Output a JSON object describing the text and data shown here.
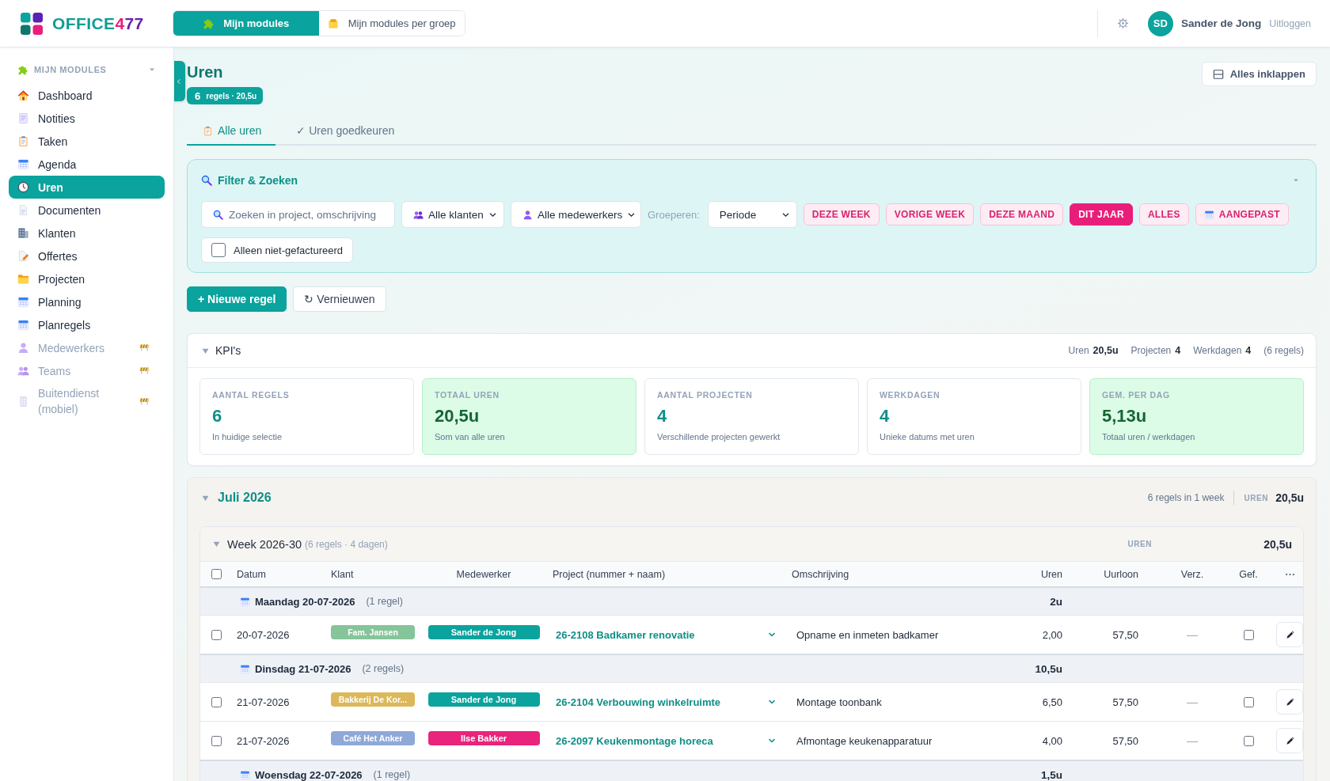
{
  "header": {
    "logo": {
      "word": "OFFICE",
      "number": "477"
    },
    "module_tabs": [
      {
        "label": "Mijn modules",
        "selected": true
      },
      {
        "label": "Mijn modules per groep",
        "selected": false
      }
    ],
    "user": {
      "initials": "SD",
      "name": "Sander de Jong"
    },
    "logout": "Uitloggen"
  },
  "sidebar": {
    "title": "MIJN MODULES",
    "items": [
      {
        "label": "Dashboard",
        "selected": false,
        "disabled": false
      },
      {
        "label": "Notities",
        "selected": false,
        "disabled": false
      },
      {
        "label": "Taken",
        "selected": false,
        "disabled": false
      },
      {
        "label": "Agenda",
        "selected": false,
        "disabled": false
      },
      {
        "label": "Uren",
        "selected": true,
        "disabled": false
      },
      {
        "label": "Documenten",
        "selected": false,
        "disabled": false
      },
      {
        "label": "Klanten",
        "selected": false,
        "disabled": false
      },
      {
        "label": "Offertes",
        "selected": false,
        "disabled": false
      },
      {
        "label": "Projecten",
        "selected": false,
        "disabled": false
      },
      {
        "label": "Planning",
        "selected": false,
        "disabled": false
      },
      {
        "label": "Planregels",
        "selected": false,
        "disabled": false
      },
      {
        "label": "Medewerkers",
        "selected": false,
        "disabled": true
      },
      {
        "label": "Teams",
        "selected": false,
        "disabled": true
      },
      {
        "label": "Buitendienst (mobiel)",
        "selected": false,
        "disabled": true
      }
    ]
  },
  "page": {
    "title": "Uren",
    "badge": {
      "count": "6",
      "label": "regels · 20,5u"
    },
    "collapse_all": "Alles inklappen",
    "tabs": [
      {
        "label": "Alle uren",
        "selected": true
      },
      {
        "label": "✓ Uren goedkeuren",
        "selected": false
      }
    ]
  },
  "filter": {
    "title": "Filter & Zoeken",
    "search": {
      "placeholder": "Zoeken in project, omschrijving"
    },
    "client_select": "Alle klanten",
    "employee_select": "Alle medewerkers",
    "group_label": "Groeperen:",
    "group_select": "Periode",
    "periods": [
      {
        "label": "DEZE WEEK",
        "selected": false
      },
      {
        "label": "VORIGE WEEK",
        "selected": false
      },
      {
        "label": "DEZE MAAND",
        "selected": false
      },
      {
        "label": "DIT JAAR",
        "selected": true
      },
      {
        "label": "ALLES",
        "selected": false
      },
      {
        "label": "AANGEPAST",
        "selected": false
      }
    ],
    "only_unbilled": {
      "label": "Alleen niet-gefactureerd",
      "checked": false
    }
  },
  "actions": [
    {
      "label": "+ Nieuwe regel",
      "kind": "primary"
    },
    {
      "label": "↻ Vernieuwen",
      "kind": "secondary"
    }
  ],
  "kpis": {
    "title": "KPI's",
    "expanded": true,
    "summary": [
      {
        "label": "Uren",
        "value": "20,5u"
      },
      {
        "label": "Projecten",
        "value": "4"
      },
      {
        "label": "Werkdagen",
        "value": "4"
      }
    ],
    "summary_note": "(6 regels)",
    "cards": [
      {
        "label": "AANTAL REGELS",
        "value": "6",
        "description": "In huidige selectie",
        "highlight": false
      },
      {
        "label": "TOTAAL UREN",
        "value": "20,5u",
        "description": "Som van alle uren",
        "highlight": true
      },
      {
        "label": "AANTAL PROJECTEN",
        "value": "4",
        "description": "Verschillende projecten gewerkt",
        "highlight": false
      },
      {
        "label": "WERKDAGEN",
        "value": "4",
        "description": "Unieke datums met uren",
        "highlight": false
      },
      {
        "label": "GEM. PER DAG",
        "value": "5,13u",
        "description": "Totaal uren / werkdagen",
        "highlight": true
      }
    ]
  },
  "month": {
    "title": "Juli 2026",
    "expanded": true,
    "summary": "6 regels in 1 week",
    "total_label": "UREN",
    "total": "20,5u",
    "week": {
      "title": "Week 2026-30",
      "note": "(6 regels · 4 dagen)",
      "expanded": true,
      "total_label": "UREN",
      "total": "20,5u",
      "table": {
        "all_selected": false,
        "columns": [
          "Datum",
          "Klant",
          "Medewerker",
          "Project (nummer + naam)",
          "Omschrijving",
          "Uren",
          "Uurloon",
          "Verz.",
          "Gef.",
          "⋯"
        ],
        "days": [
          {
            "title": "Maandag 20-07-2026",
            "count": "(1 regel)",
            "total": "2u",
            "rows": [
              {
                "selected": false,
                "date": "20-07-2026",
                "client": {
                  "name": "Fam. Jansen",
                  "color": "#86c49a"
                },
                "employee": {
                  "name": "Sander de Jong",
                  "color": "#0aa39d"
                },
                "project": "26-2108 Badkamer renovatie",
                "description": "Opname en inmeten badkamer",
                "hours": "2,00",
                "rate": "57,50",
                "sent": "—",
                "billed": false
              }
            ]
          },
          {
            "title": "Dinsdag 21-07-2026",
            "count": "(2 regels)",
            "total": "10,5u",
            "rows": [
              {
                "selected": false,
                "date": "21-07-2026",
                "client": {
                  "name": "Bakkerij De Kor...",
                  "color": "#dcb85a"
                },
                "employee": {
                  "name": "Sander de Jong",
                  "color": "#0aa39d"
                },
                "project": "26-2104 Verbouwing winkelruimte",
                "description": "Montage toonbank",
                "hours": "6,50",
                "rate": "57,50",
                "sent": "—",
                "billed": false
              },
              {
                "selected": false,
                "date": "21-07-2026",
                "client": {
                  "name": "Café Het Anker",
                  "color": "#8ea9d8"
                },
                "employee": {
                  "name": "Ilse Bakker",
                  "color": "#e9247c"
                },
                "project": "26-2097 Keukenmontage horeca",
                "description": "Afmontage keukenapparatuur",
                "hours": "4,00",
                "rate": "57,50",
                "sent": "—",
                "billed": false
              }
            ]
          },
          {
            "title": "Woensdag 22-07-2026",
            "count": "(1 regel)",
            "total": "1,5u"
          }
        ]
      }
    }
  }
}
